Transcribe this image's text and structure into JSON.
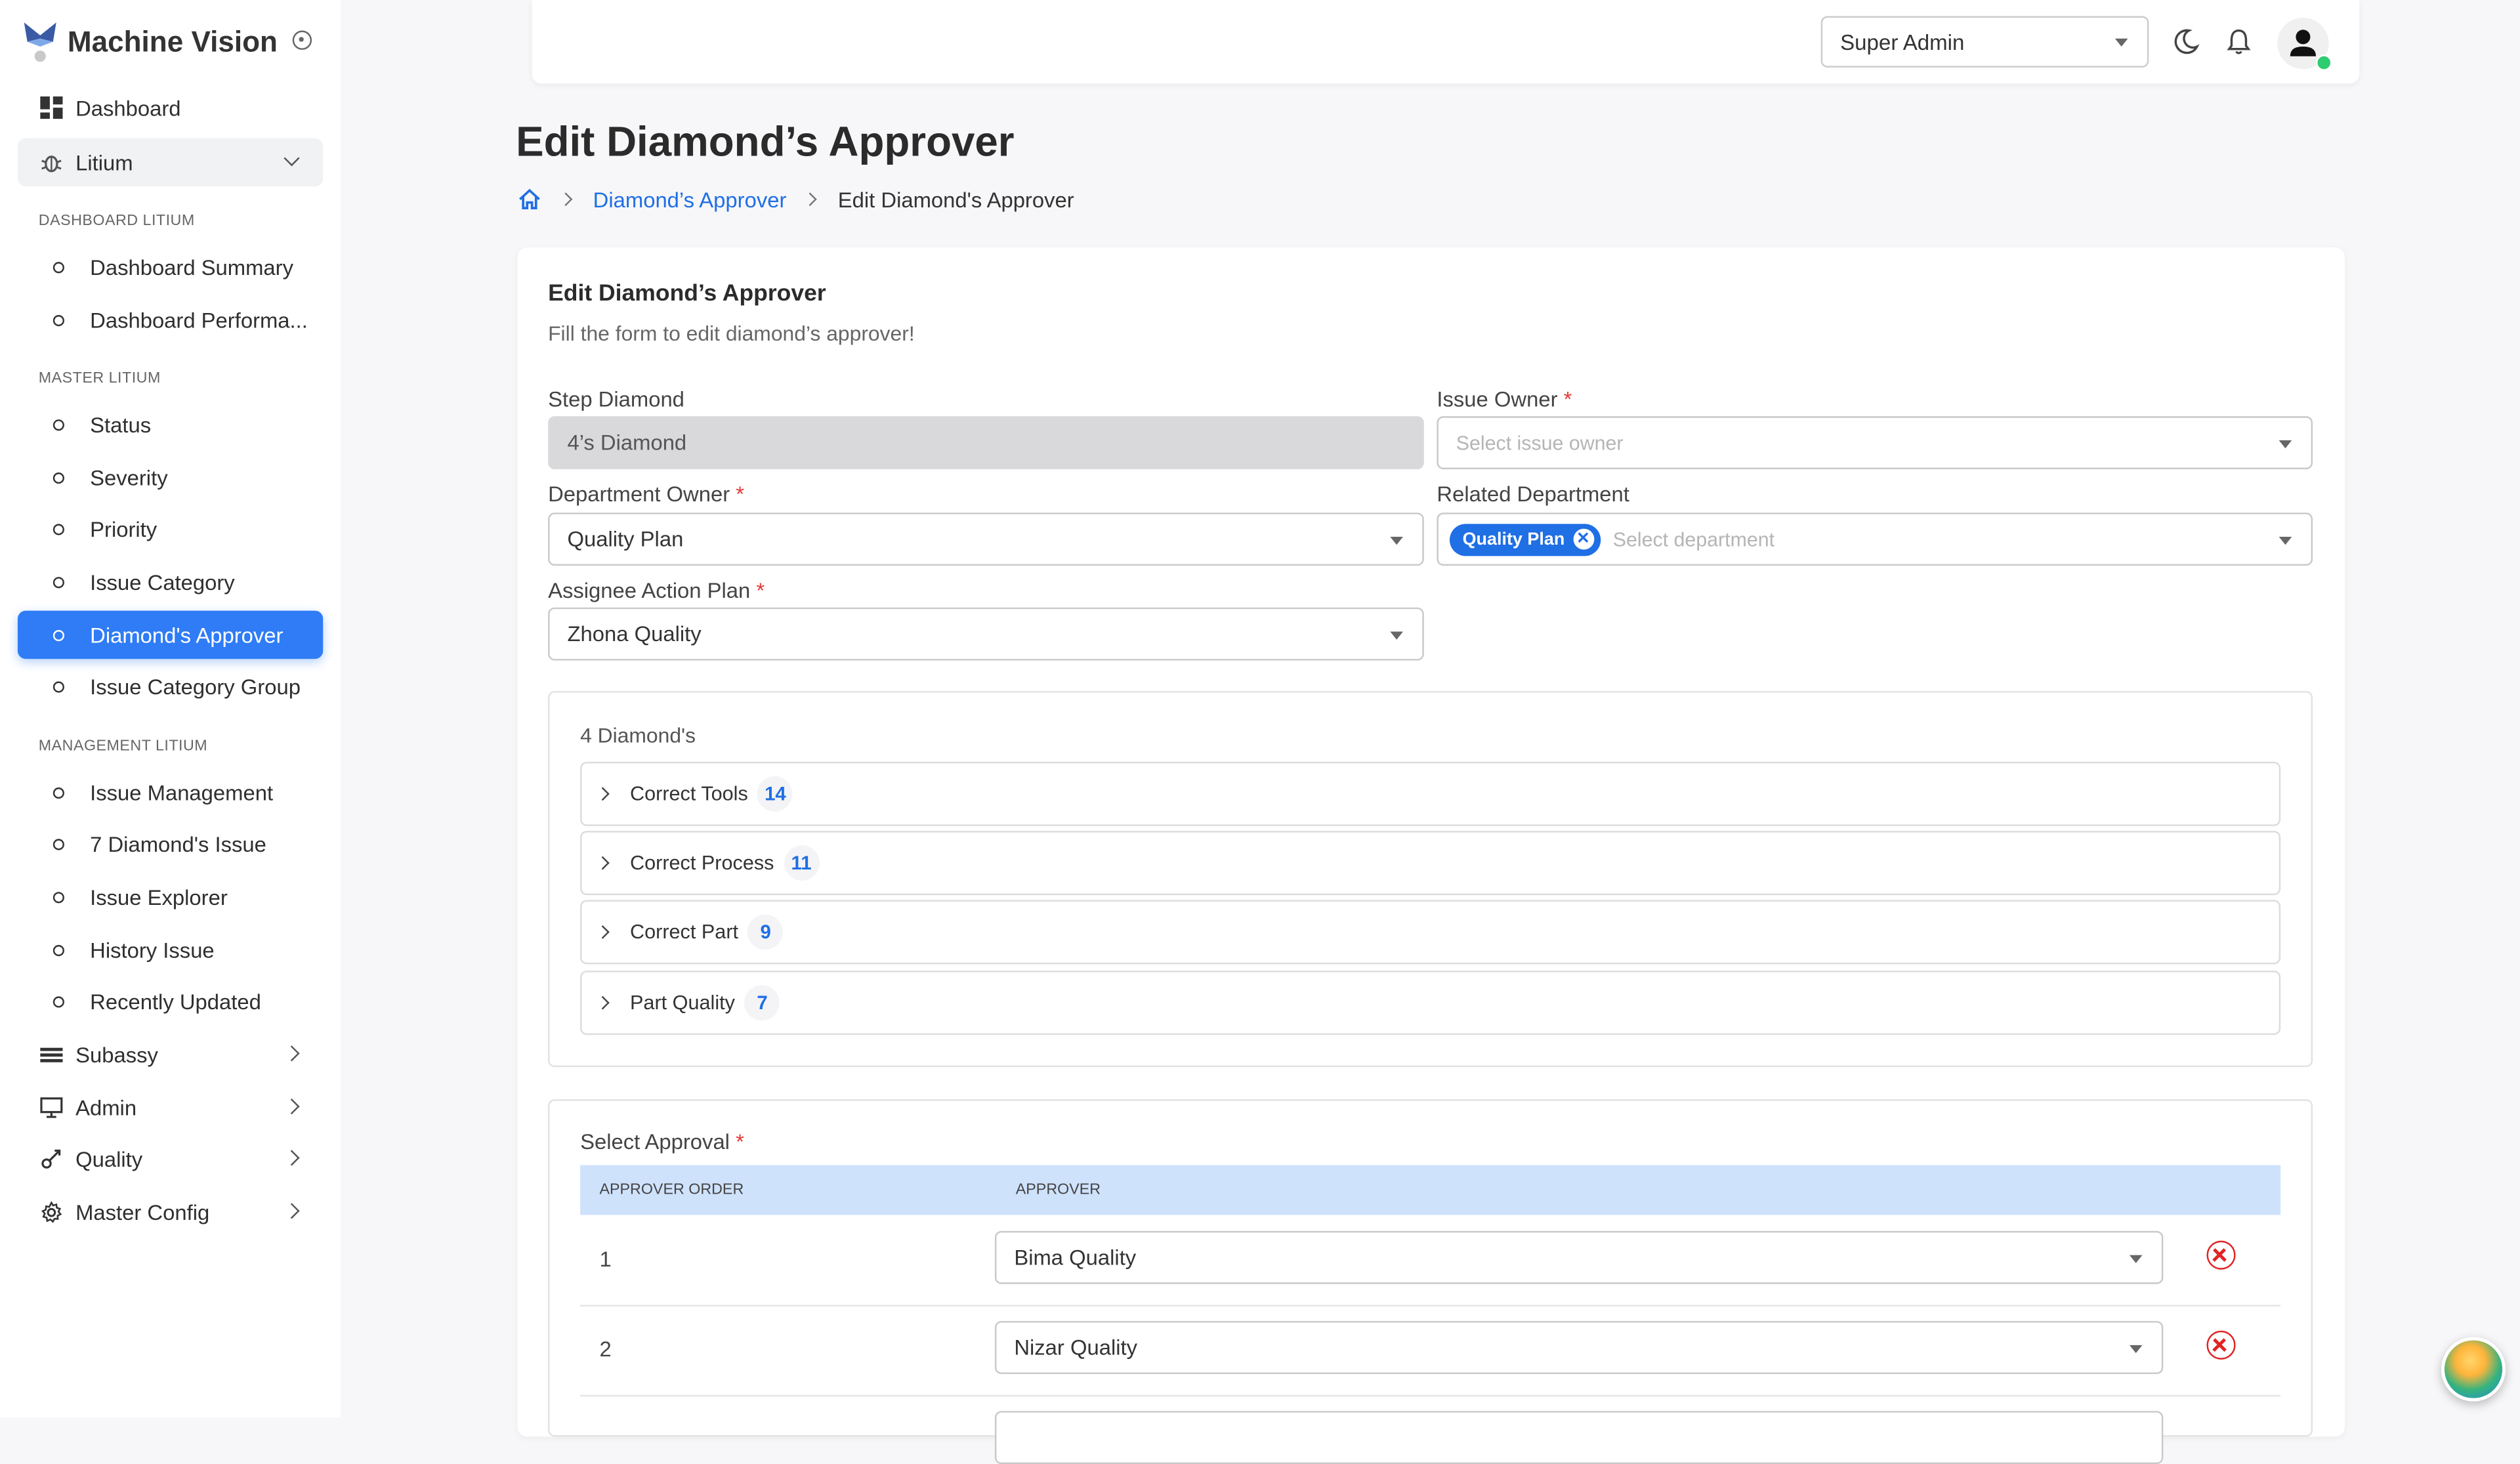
{
  "app": {
    "name": "Machine Vision"
  },
  "sidebar": {
    "dashboard": "Dashboard",
    "group_litium": "Litium",
    "section_dashboard": "DASHBOARD LITIUM",
    "dashboard_items": [
      "Dashboard Summary",
      "Dashboard Performa..."
    ],
    "section_master": "MASTER LITIUM",
    "master_items": [
      "Status",
      "Severity",
      "Priority",
      "Issue Category",
      "Diamond's Approver",
      "Issue Category Group"
    ],
    "section_management": "MANAGEMENT LITIUM",
    "management_items": [
      "Issue Management",
      "7 Diamond's Issue",
      "Issue Explorer",
      "History Issue",
      "Recently Updated"
    ],
    "groups": [
      "Subassy",
      "Admin",
      "Quality",
      "Master Config"
    ],
    "active_item": "Diamond's Approver"
  },
  "header": {
    "role": "Super Admin"
  },
  "page": {
    "title": "Edit Diamond’s Approver",
    "breadcrumb": {
      "parent": "Diamond’s Approver",
      "current": "Edit Diamond's Approver"
    }
  },
  "form": {
    "title": "Edit Diamond’s Approver",
    "subtitle": "Fill the form to edit diamond’s approver!",
    "step_diamond": {
      "label": "Step Diamond",
      "value": "4’s Diamond"
    },
    "issue_owner": {
      "label": "Issue Owner",
      "placeholder": "Select issue owner",
      "required": "*"
    },
    "department_owner": {
      "label": "Department Owner",
      "value": "Quality Plan",
      "required": "*"
    },
    "related_department": {
      "label": "Related Department",
      "chip": "Quality Plan",
      "placeholder": "Select department"
    },
    "assignee_action_plan": {
      "label": "Assignee Action Plan",
      "value": "Zhona Quality",
      "required": "*"
    }
  },
  "diamonds": {
    "title": "4 Diamond's",
    "items": [
      {
        "label": "Correct Tools",
        "count": "14"
      },
      {
        "label": "Correct Process",
        "count": "11"
      },
      {
        "label": "Correct Part",
        "count": "9"
      },
      {
        "label": "Part Quality",
        "count": "7"
      }
    ]
  },
  "approval": {
    "label": "Select Approval",
    "required": "*",
    "columns": [
      "APPROVER ORDER",
      "APPROVER"
    ],
    "rows": [
      {
        "order": "1",
        "approver": "Bima Quality"
      },
      {
        "order": "2",
        "approver": "Nizar Quality"
      }
    ]
  },
  "colors": {
    "primary": "#2f7cf6",
    "link": "#1f6fe5",
    "danger": "#e02424",
    "table_header": "#cfe2fc"
  }
}
